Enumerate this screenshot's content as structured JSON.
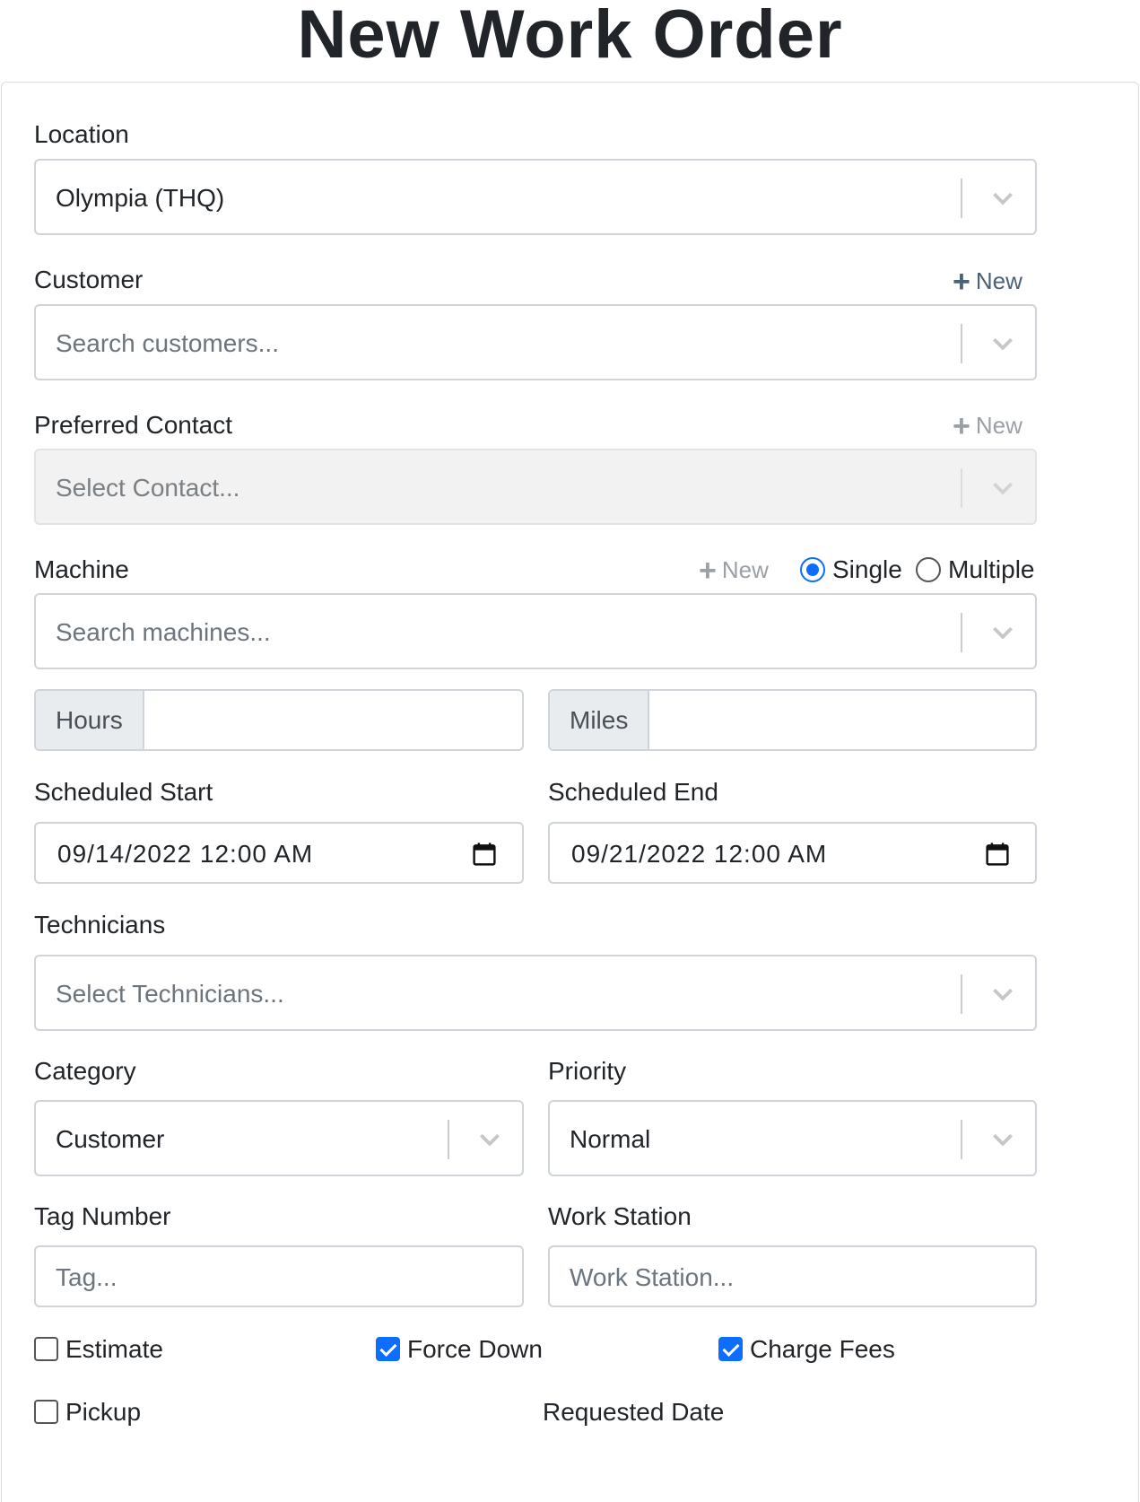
{
  "header": {
    "title": "New Work Order"
  },
  "form": {
    "location": {
      "label": "Location",
      "value": "Olympia (THQ)"
    },
    "customer": {
      "label": "Customer",
      "placeholder": "Search customers...",
      "new_label": "New"
    },
    "preferred_contact": {
      "label": "Preferred Contact",
      "placeholder": "Select Contact...",
      "new_label": "New"
    },
    "machine": {
      "label": "Machine",
      "placeholder": "Search machines...",
      "new_label": "New",
      "mode_single": "Single",
      "mode_multiple": "Multiple",
      "selected_mode": "Single"
    },
    "hours": {
      "addon": "Hours",
      "value": ""
    },
    "miles": {
      "addon": "Miles",
      "value": ""
    },
    "scheduled_start": {
      "label": "Scheduled Start",
      "value": "09/14/2022  12:00  AM"
    },
    "scheduled_end": {
      "label": "Scheduled End",
      "value": "09/21/2022  12:00  AM"
    },
    "technicians": {
      "label": "Technicians",
      "placeholder": "Select Technicians..."
    },
    "category": {
      "label": "Category",
      "value": "Customer"
    },
    "priority": {
      "label": "Priority",
      "value": "Normal"
    },
    "tag_number": {
      "label": "Tag Number",
      "placeholder": "Tag..."
    },
    "work_station": {
      "label": "Work Station",
      "placeholder": "Work Station..."
    },
    "checkboxes": {
      "estimate": {
        "label": "Estimate",
        "checked": false
      },
      "force_down": {
        "label": "Force Down",
        "checked": true
      },
      "charge_fees": {
        "label": "Charge Fees",
        "checked": true
      },
      "pickup": {
        "label": "Pickup",
        "checked": false
      }
    },
    "requested_date": {
      "label": "Requested Date"
    }
  },
  "colors": {
    "accent": "#0d6efd",
    "border": "#ced4da",
    "link": "#4a6178"
  }
}
